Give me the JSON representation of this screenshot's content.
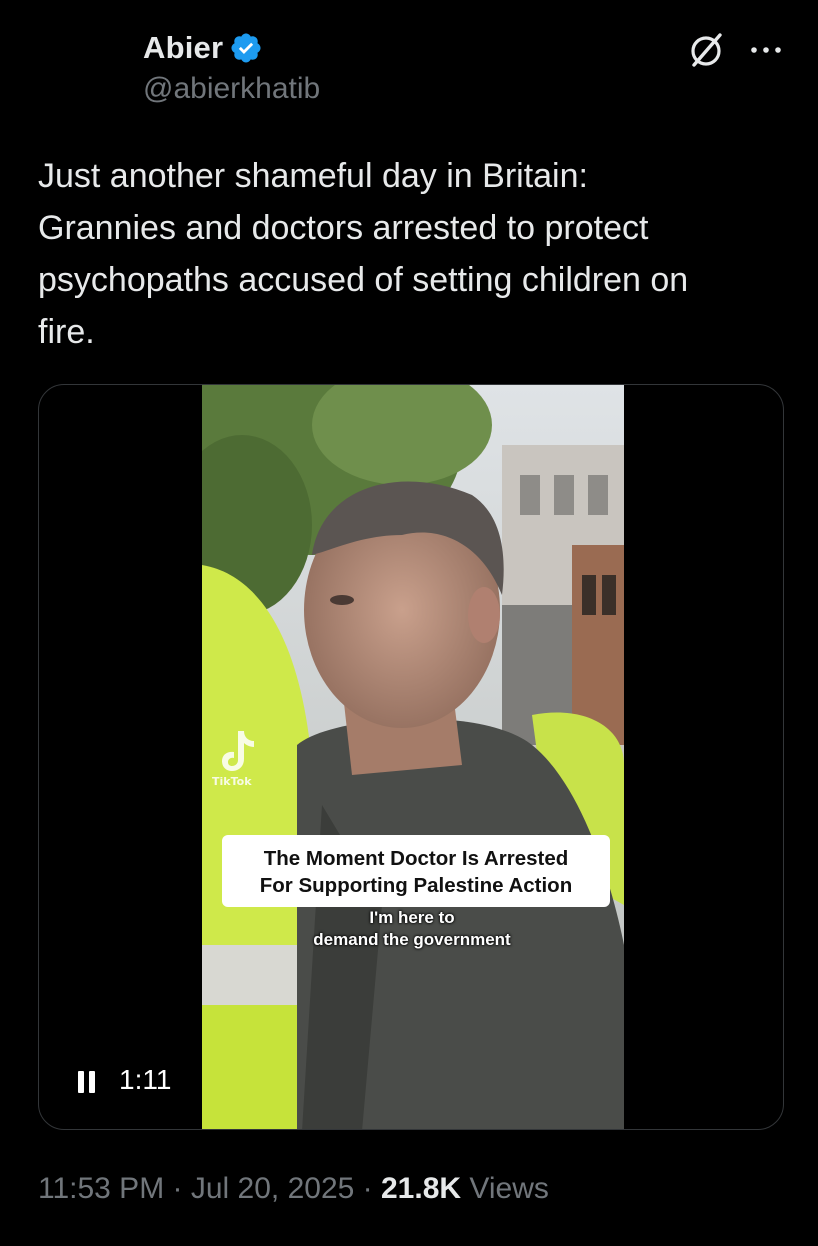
{
  "author": {
    "display_name": "Abier",
    "handle": "@abierkhatib",
    "verified": true
  },
  "icons": {
    "verified": "verified-badge-icon",
    "grok": "grok-icon",
    "more": "more-options-icon",
    "pause": "pause-icon",
    "tiktok": "tiktok-logo-icon"
  },
  "tweet": {
    "text": "Just another shameful day in Britain:\nGrannies and doctors arrested to protect\npsychopaths accused of setting children on\nfire."
  },
  "video": {
    "caption_line1": "The Moment Doctor Is Arrested",
    "caption_line2": "For Supporting Palestine Action",
    "subtitle_line1": "I'm here to",
    "subtitle_line2": "demand the government",
    "watermark": "TikTok",
    "duration": "1:11"
  },
  "meta": {
    "time": "11:53 PM",
    "sep1": " · ",
    "date": "Jul 20, 2025",
    "sep2": " · ",
    "views_count": "21.8K",
    "views_label": " Views"
  },
  "colors": {
    "background": "#000000",
    "text": "#e7e9ea",
    "secondary": "#71767b",
    "verified": "#1d9bf0",
    "border": "#333639"
  }
}
